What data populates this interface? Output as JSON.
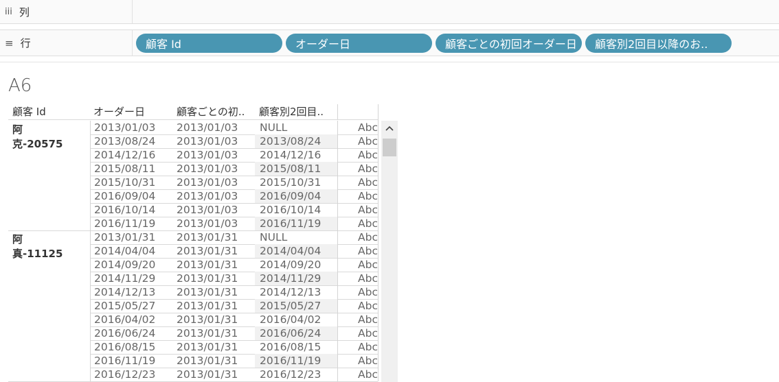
{
  "shelves": {
    "columns": {
      "icon": "iii",
      "label": "列",
      "pills": []
    },
    "rows": {
      "icon": "≡",
      "label": "行",
      "pills": [
        "顧客 Id",
        "オーダー日",
        "顧客ごとの初回オーダー日",
        "顧客別2回目以降のお.."
      ]
    }
  },
  "sheet_title": "A6",
  "table": {
    "headers": [
      "顧客 Id",
      "オーダー日",
      "顧客ごとの初..",
      "顧客別2回目.."
    ],
    "groups": [
      {
        "customer": "阿克-20575",
        "rows": [
          [
            "2013/01/03",
            "2013/01/03",
            "NULL",
            "Abc"
          ],
          [
            "2013/08/24",
            "2013/01/03",
            "2013/08/24",
            "Abc"
          ],
          [
            "2014/12/16",
            "2013/01/03",
            "2014/12/16",
            "Abc"
          ],
          [
            "2015/08/11",
            "2013/01/03",
            "2015/08/11",
            "Abc"
          ],
          [
            "2015/10/31",
            "2013/01/03",
            "2015/10/31",
            "Abc"
          ],
          [
            "2016/09/04",
            "2013/01/03",
            "2016/09/04",
            "Abc"
          ],
          [
            "2016/10/14",
            "2013/01/03",
            "2016/10/14",
            "Abc"
          ],
          [
            "2016/11/19",
            "2013/01/03",
            "2016/11/19",
            "Abc"
          ]
        ]
      },
      {
        "customer": "阿真-11125",
        "rows": [
          [
            "2013/01/31",
            "2013/01/31",
            "NULL",
            "Abc"
          ],
          [
            "2014/04/04",
            "2013/01/31",
            "2014/04/04",
            "Abc"
          ],
          [
            "2014/09/20",
            "2013/01/31",
            "2014/09/20",
            "Abc"
          ],
          [
            "2014/11/29",
            "2013/01/31",
            "2014/11/29",
            "Abc"
          ],
          [
            "2014/12/13",
            "2013/01/31",
            "2014/12/13",
            "Abc"
          ],
          [
            "2015/05/27",
            "2013/01/31",
            "2015/05/27",
            "Abc"
          ],
          [
            "2016/04/02",
            "2013/01/31",
            "2016/04/02",
            "Abc"
          ],
          [
            "2016/06/24",
            "2013/01/31",
            "2016/06/24",
            "Abc"
          ],
          [
            "2016/08/15",
            "2013/01/31",
            "2016/08/15",
            "Abc"
          ],
          [
            "2016/11/19",
            "2013/01/31",
            "2016/11/19",
            "Abc"
          ],
          [
            "2016/12/23",
            "2013/01/31",
            "2016/12/23",
            "Abc"
          ]
        ]
      }
    ]
  },
  "colors": {
    "pill": "#4996b2",
    "shelf_bg": "#fafafa",
    "row_shade": "#f1f1f1"
  }
}
